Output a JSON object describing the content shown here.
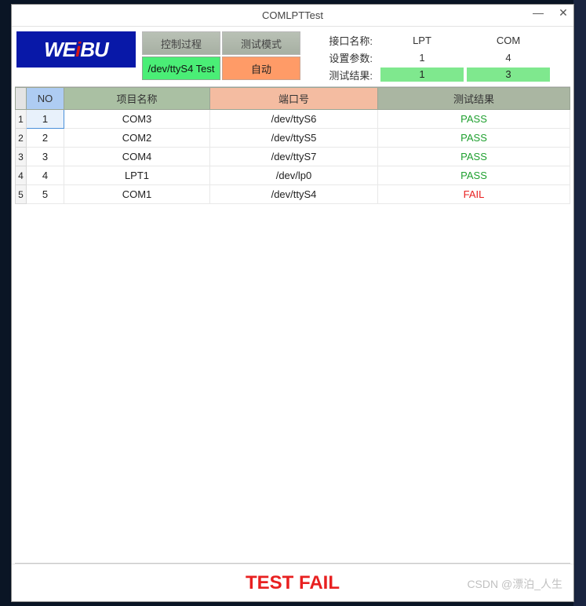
{
  "window": {
    "title": "COMLPTTest"
  },
  "logo": {
    "text_pre": "WE",
    "text_red": "i",
    "text_post": "BU"
  },
  "buttons": {
    "control_process": "控制过程",
    "test_mode": "测试模式",
    "dev_test": "/dev/ttyS4 Test",
    "auto": "自动"
  },
  "info": {
    "name_label": "接口名称:",
    "param_label": "设置参数:",
    "result_label": "测试结果:",
    "col_lpt": "LPT",
    "col_com": "COM",
    "param_lpt": "1",
    "param_com": "4",
    "result_lpt": "1",
    "result_com": "3"
  },
  "table": {
    "headers": {
      "no": "NO",
      "name": "项目名称",
      "port": "端口号",
      "result": "测试结果"
    },
    "rows": [
      {
        "idx": "1",
        "no": "1",
        "name": "COM3",
        "port": "/dev/ttyS6",
        "result": "PASS",
        "status": "pass"
      },
      {
        "idx": "2",
        "no": "2",
        "name": "COM2",
        "port": "/dev/ttyS5",
        "result": "PASS",
        "status": "pass"
      },
      {
        "idx": "3",
        "no": "3",
        "name": "COM4",
        "port": "/dev/ttyS7",
        "result": "PASS",
        "status": "pass"
      },
      {
        "idx": "4",
        "no": "4",
        "name": "LPT1",
        "port": "/dev/lp0",
        "result": "PASS",
        "status": "pass"
      },
      {
        "idx": "5",
        "no": "5",
        "name": "COM1",
        "port": "/dev/ttyS4",
        "result": "FAIL",
        "status": "fail"
      }
    ]
  },
  "footer": {
    "status": "TEST FAIL"
  },
  "watermark": "CSDN @漂泊_人生"
}
